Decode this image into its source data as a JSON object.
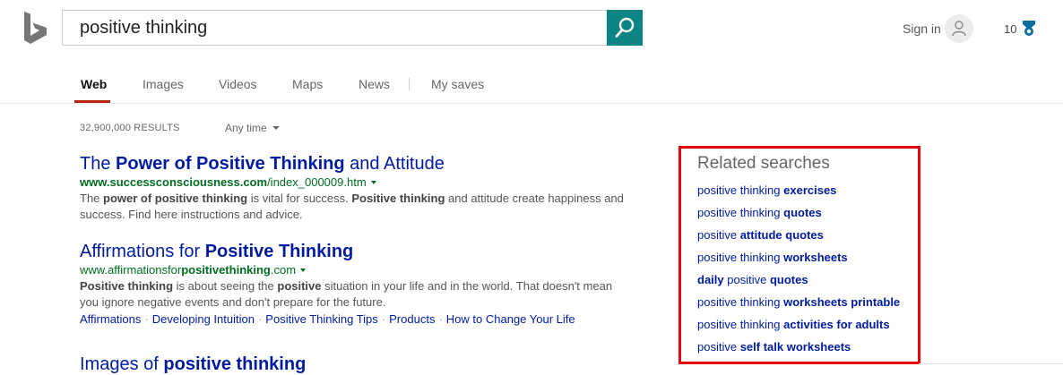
{
  "search": {
    "query": "positive thinking"
  },
  "header": {
    "sign_in": "Sign in",
    "rewards_points": "10"
  },
  "tabs": [
    {
      "label": "Web",
      "active": true
    },
    {
      "label": "Images",
      "active": false
    },
    {
      "label": "Videos",
      "active": false
    },
    {
      "label": "Maps",
      "active": false
    },
    {
      "label": "News",
      "active": false
    },
    {
      "label": "My saves",
      "active": false
    }
  ],
  "results_meta": {
    "count": "32,900,000 RESULTS",
    "time_filter": "Any time"
  },
  "results": [
    {
      "title": [
        {
          "text": "The ",
          "bold": false
        },
        {
          "text": "Power of Positive Thinking",
          "bold": true
        },
        {
          "text": " and Attitude",
          "bold": false
        }
      ],
      "url": [
        {
          "text": "www.successconsciousness.com",
          "bold": true
        },
        {
          "text": "/index_000009.htm",
          "bold": false
        }
      ],
      "snippet": [
        {
          "text": "The ",
          "bold": false
        },
        {
          "text": "power of positive thinking",
          "bold": true
        },
        {
          "text": " is vital for success. ",
          "bold": false
        },
        {
          "text": "Positive thinking",
          "bold": true
        },
        {
          "text": " and attitude create happiness and success. Find here instructions and advice.",
          "bold": false
        }
      ],
      "sitelinks": []
    },
    {
      "title": [
        {
          "text": "Affirmations for ",
          "bold": false
        },
        {
          "text": "Positive Thinking",
          "bold": true
        }
      ],
      "url": [
        {
          "text": "www.affirmationsfor",
          "bold": false
        },
        {
          "text": "positivethinking",
          "bold": true
        },
        {
          "text": ".com",
          "bold": false
        }
      ],
      "snippet": [
        {
          "text": "Positive thinking",
          "bold": true
        },
        {
          "text": " is about seeing the ",
          "bold": false
        },
        {
          "text": "positive",
          "bold": true
        },
        {
          "text": " situation in your life and in the world. That doesn't mean you ignore negative events and don't prepare for the future.",
          "bold": false
        }
      ],
      "sitelinks": [
        "Affirmations",
        "Developing Intuition",
        "Positive Thinking Tips",
        "Products",
        "How to Change Your Life"
      ]
    },
    {
      "title": [
        {
          "text": "Images of ",
          "bold": false
        },
        {
          "text": "positive thinking",
          "bold": true
        }
      ],
      "url": [],
      "snippet": [],
      "sitelinks": []
    }
  ],
  "related": {
    "title": "Related searches",
    "items": [
      [
        {
          "text": "positive thinking ",
          "bold": false
        },
        {
          "text": "exercises",
          "bold": true
        }
      ],
      [
        {
          "text": "positive thinking ",
          "bold": false
        },
        {
          "text": "quotes",
          "bold": true
        }
      ],
      [
        {
          "text": "positive ",
          "bold": false
        },
        {
          "text": "attitude quotes",
          "bold": true
        }
      ],
      [
        {
          "text": "positive thinking ",
          "bold": false
        },
        {
          "text": "worksheets",
          "bold": true
        }
      ],
      [
        {
          "text": "daily",
          "bold": true
        },
        {
          "text": " positive ",
          "bold": false
        },
        {
          "text": "quotes",
          "bold": true
        }
      ],
      [
        {
          "text": "positive thinking ",
          "bold": false
        },
        {
          "text": "worksheets printable",
          "bold": true
        }
      ],
      [
        {
          "text": "positive thinking ",
          "bold": false
        },
        {
          "text": "activities for adults",
          "bold": true
        }
      ],
      [
        {
          "text": "positive ",
          "bold": false
        },
        {
          "text": "self talk worksheets",
          "bold": true
        }
      ]
    ]
  },
  "colors": {
    "brand_teal": "#0c8484",
    "link_blue": "#001ba0",
    "url_green": "#006d21",
    "highlight_red": "#e8040e",
    "tab_accent": "#b6250f"
  },
  "icons": {
    "logo": "bing-logo-icon",
    "search": "magnifier-icon",
    "avatar": "user-icon",
    "rewards": "medal-icon"
  }
}
